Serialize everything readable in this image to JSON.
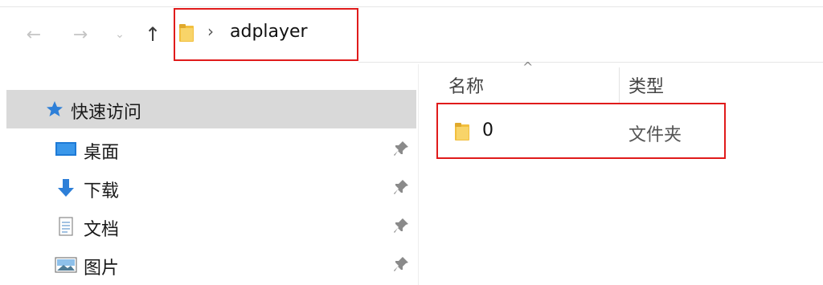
{
  "nav": {
    "back_icon": "←",
    "forward_icon": "→",
    "recent_icon": "⌄",
    "up_icon": "↑"
  },
  "address": {
    "chevron": "›",
    "path": "adplayer"
  },
  "sidebar": {
    "quick_access": "快速访问",
    "items": [
      {
        "label": "桌面",
        "icon": "desktop-icon"
      },
      {
        "label": "下载",
        "icon": "download-icon"
      },
      {
        "label": "文档",
        "icon": "document-icon"
      },
      {
        "label": "图片",
        "icon": "pictures-icon"
      }
    ]
  },
  "columns": {
    "sort_indicator": "^",
    "name": "名称",
    "type": "类型"
  },
  "files": [
    {
      "name": "0",
      "type": "文件夹"
    }
  ],
  "colors": {
    "highlight_border": "#e01b1b",
    "folder": "#f7c948",
    "selected_row": "#d9d9d9"
  }
}
